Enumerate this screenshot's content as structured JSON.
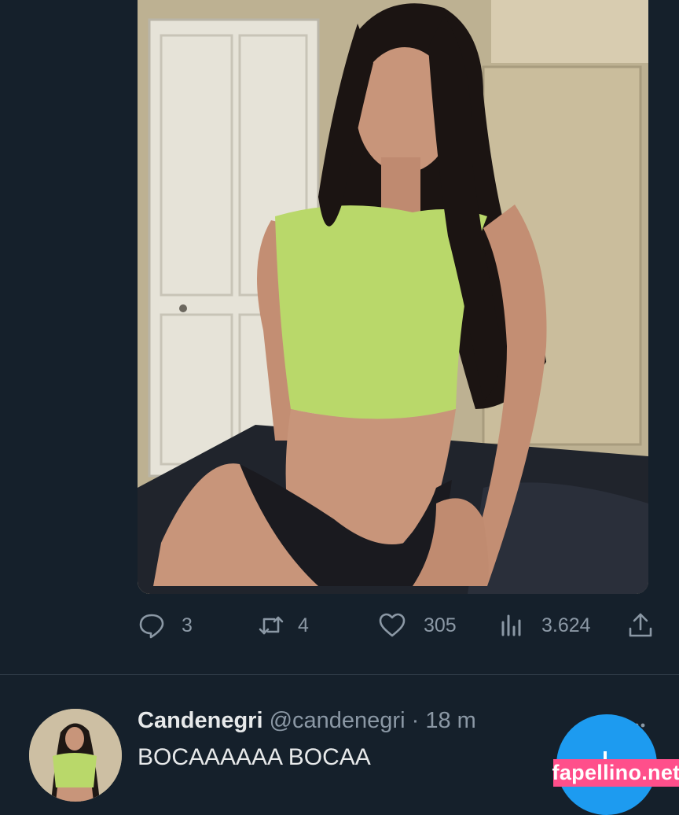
{
  "media": {
    "description_icon": "photo"
  },
  "actions": {
    "reply": {
      "icon": "reply-bubble-icon",
      "count": "3"
    },
    "retweet": {
      "icon": "retweet-icon",
      "count": "4"
    },
    "like": {
      "icon": "heart-icon",
      "count": "305"
    },
    "views": {
      "icon": "views-bar-chart-icon",
      "count": "3.624"
    },
    "share": {
      "icon": "share-upload-icon"
    }
  },
  "reply_tweet": {
    "display_name": "Candenegri",
    "handle": "@candenegri",
    "separator": "·",
    "time": "18 m",
    "text": "BOCAAAAAA BOCAA"
  },
  "watermark": "fapellino.net",
  "colors": {
    "background": "#15202b",
    "muted": "#8b98a5",
    "accent": "#1d9bf0",
    "watermark": "#ff4f8b"
  }
}
